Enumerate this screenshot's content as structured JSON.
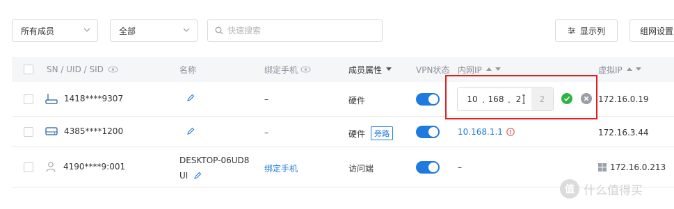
{
  "filters": {
    "member_select": "所有成员",
    "type_select": "全部",
    "search_placeholder": "快速搜索"
  },
  "actions": {
    "columns_button": "显示列",
    "network_settings_button": "组网设置"
  },
  "table": {
    "headers": {
      "sn": "SN / UID / SID",
      "name": "名称",
      "phone": "绑定手机",
      "attr": "成员属性",
      "vpn": "VPN状态",
      "lan_ip": "内网IP",
      "virtual_ip": "虚拟IP"
    },
    "rows": [
      {
        "id": "1418****9307",
        "device_icon": "router-icon",
        "name": "",
        "phone": "–",
        "attr": "硬件",
        "tag": "",
        "vpn_on": true,
        "lan_ip_segments": [
          "10",
          "168",
          "2",
          "2"
        ],
        "virtual_ip": "172.16.0.19"
      },
      {
        "id": "4385****1200",
        "device_icon": "hard-drive-icon",
        "name": "",
        "phone": "–",
        "attr": "硬件",
        "tag": "旁路",
        "vpn_on": true,
        "lan_ip": "10.168.1.1",
        "virtual_ip": "172.16.3.44"
      },
      {
        "id": "4190****9:001",
        "device_icon": "user-icon",
        "name_line1": "DESKTOP-06UD8",
        "name_line2": "UI",
        "phone": "绑定手机",
        "attr": "访问端",
        "tag": "",
        "vpn_on": true,
        "lan_ip": "–",
        "virtual_ip": "172.16.0.213",
        "os_icon": "windows-icon"
      }
    ]
  },
  "watermark": {
    "badge": "值",
    "text": "什么值得买"
  },
  "colors": {
    "accent": "#1f7ae0",
    "highlight": "#e02020",
    "confirm": "#2fb344",
    "header_bg": "#f5f6f8"
  }
}
